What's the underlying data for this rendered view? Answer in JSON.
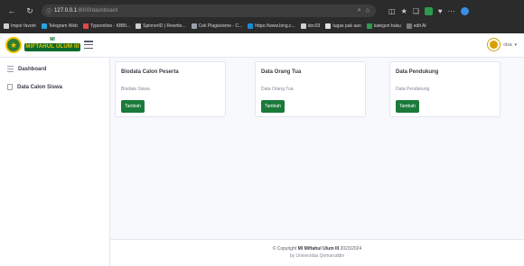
{
  "browser": {
    "url_host": "127.0.0.1",
    "url_path": ":8000/dashboard",
    "bookmarks": [
      {
        "label": "Impor favorit",
        "color": "#cfcfcf"
      },
      {
        "label": "Telegram Web",
        "color": "#2aa3e0"
      },
      {
        "label": "Typeonline - KBBI...",
        "color": "#e04848"
      },
      {
        "label": "SpinnerID | Rewrite...",
        "color": "#cfcfcf"
      },
      {
        "label": "Cek Plagiarisme - C...",
        "color": "#9aa0ac"
      },
      {
        "label": "https://www.bing.c...",
        "color": "#1a8ad4"
      },
      {
        "label": "doc03",
        "color": "#cfcfcf"
      },
      {
        "label": "tugas pak aan",
        "color": "#e0e0e0"
      },
      {
        "label": "kategori buku",
        "color": "#2d9b4e"
      },
      {
        "label": "edit AI",
        "color": "#7a7a7a"
      }
    ]
  },
  "header": {
    "brand_top": "MI",
    "brand_name": "MIFTAHUL ULUM III",
    "user_name": "olsa"
  },
  "sidebar": {
    "items": [
      {
        "label": "Dashboard"
      },
      {
        "label": "Data Calon Siswa"
      }
    ]
  },
  "cards": [
    {
      "title": "Biodata Calon Peserta",
      "text": "Biodata Siswa",
      "button": "Tambah"
    },
    {
      "title": "Data Orang Tua",
      "text": "Data Orang Tua",
      "button": "Tambah"
    },
    {
      "title": "Data Pendukung",
      "text": "Data Pendukung",
      "button": "Tambah"
    }
  ],
  "footer": {
    "copyright_prefix": "© Copyright",
    "copyright_name": "MI Miftahul Ulum III",
    "copyright_year": "2023/2024",
    "credit": "by Universitas Qomaruddin"
  },
  "colors": {
    "accent_green": "#1a7a3a",
    "brand_yellow": "#f2c200"
  }
}
